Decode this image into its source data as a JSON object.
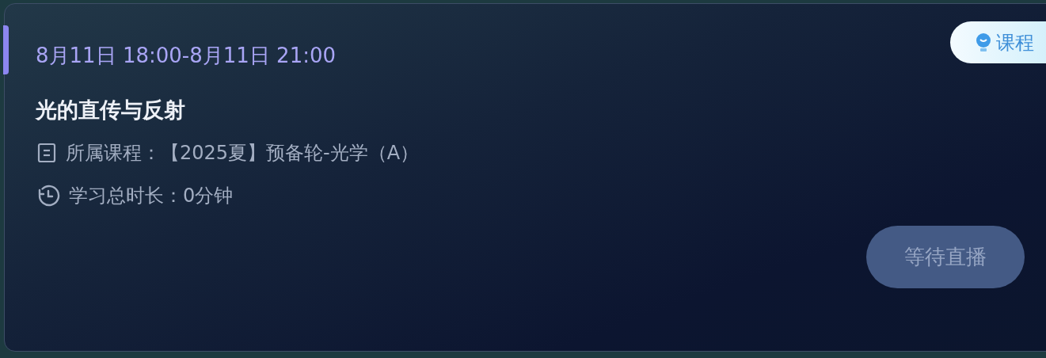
{
  "card": {
    "time": "8月11日 18:00-8月11日 21:00",
    "badge": "课程",
    "title": "光的直传与反射",
    "details": [
      {
        "kind": "course",
        "text": "所属课程：【2025夏】预备轮-光学（A）"
      },
      {
        "kind": "duration",
        "text": "学习总时长：0分钟"
      }
    ],
    "button": {
      "label": "等待直播",
      "disabled": true
    }
  }
}
